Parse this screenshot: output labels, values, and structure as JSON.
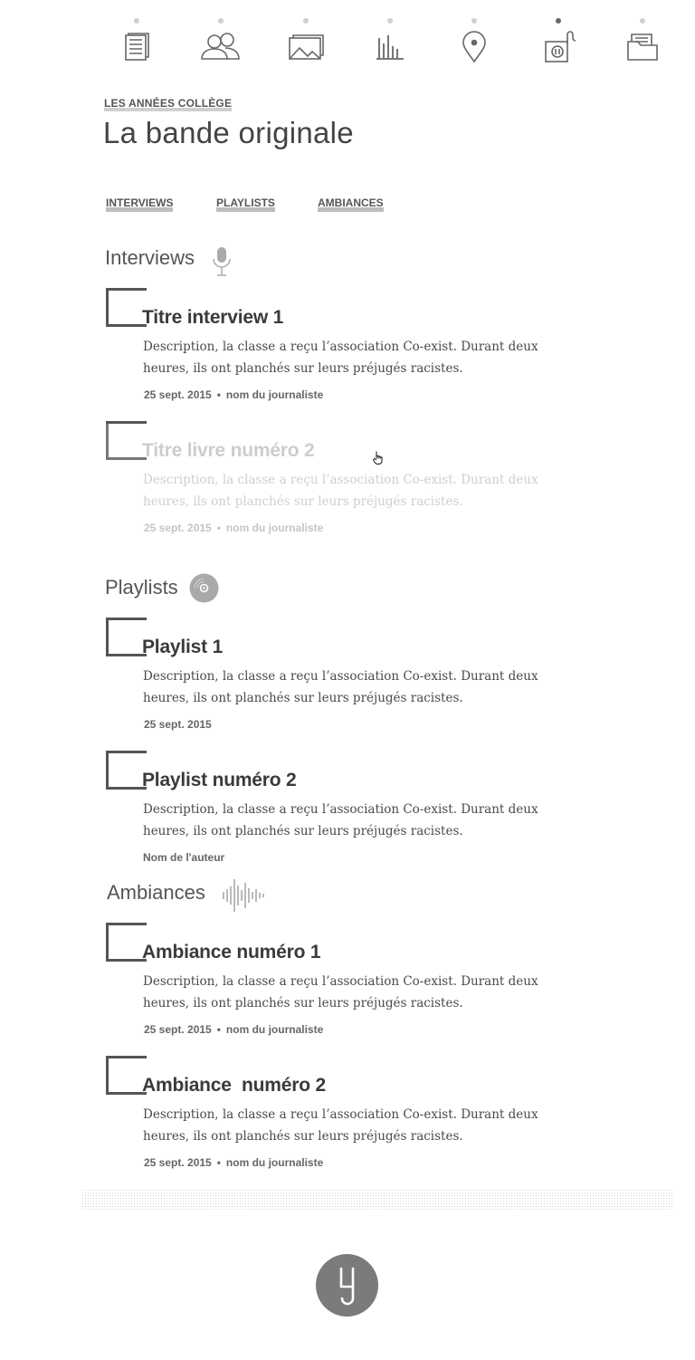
{
  "nav": {
    "items": [
      {
        "name": "articles",
        "icon": "article-icon",
        "active": false
      },
      {
        "name": "portraits",
        "icon": "people-icon",
        "active": false
      },
      {
        "name": "photos",
        "icon": "photo-icon",
        "active": false
      },
      {
        "name": "stats",
        "icon": "chart-icon",
        "active": false
      },
      {
        "name": "map",
        "icon": "location-pin-icon",
        "active": false
      },
      {
        "name": "audio",
        "icon": "radio-icon",
        "active": true
      },
      {
        "name": "archive",
        "icon": "folder-icon",
        "active": false
      }
    ]
  },
  "header": {
    "kicker": "LES ANNÉES COLLÈGE",
    "title": "La bande originale"
  },
  "tabs": [
    "INTERVIEWS",
    "PLAYLISTS",
    "AMBIANCES"
  ],
  "sections": {
    "interviews": {
      "title": "Interviews",
      "icon": "microphone-icon",
      "cards": [
        {
          "title": "Titre interview 1",
          "desc": "Description, la classe a reçu l’association Co-exist. Durant deux heures, ils ont planchés sur leurs préjugés racistes.",
          "date": "25 sept. 2015",
          "sep": "•",
          "author": "nom du journaliste"
        },
        {
          "title": "Titre livre numéro 2",
          "desc": "Description, la classe a reçu l’association Co-exist. Durant deux heures, ils ont planchés sur leurs préjugés racistes.",
          "date": "25 sept. 2015",
          "sep": "•",
          "author": "nom du journaliste"
        }
      ]
    },
    "playlists": {
      "title": "Playlists",
      "icon": "vinyl-disc-icon",
      "cards": [
        {
          "title": "Playlist 1",
          "desc": "Description, la classe a reçu l’association Co-exist. Durant deux heures, ils ont planchés sur leurs préjugés racistes.",
          "date": "25 sept. 2015"
        },
        {
          "title": "Playlist numéro 2",
          "desc": "Description, la classe a reçu l’association Co-exist. Durant deux heures, ils ont planchés sur leurs préjugés racistes.",
          "author": "Nom de l'auteur"
        }
      ]
    },
    "ambiances": {
      "title": "Ambiances",
      "icon": "soundwave-icon",
      "cards": [
        {
          "title": "Ambiance numéro 1",
          "desc": "Description, la classe a reçu l’association Co-exist. Durant deux heures, ils ont planchés sur leurs préjugés racistes.",
          "date": "25 sept. 2015",
          "sep": "•",
          "author": "nom du journaliste"
        },
        {
          "title": "Ambiance  numéro 2",
          "desc": "Description, la classe a reçu l’association Co-exist. Durant deux heures, ils ont planchés sur leurs préjugés racistes.",
          "date": "25 sept. 2015",
          "sep": "•",
          "author": "nom du journaliste"
        }
      ]
    }
  },
  "footer": {
    "logo_icon": "brand-logo-icon"
  },
  "colors": {
    "text": "#444444",
    "accent_underline": "#cfcfcf",
    "icon_gray": "#666666",
    "logo_bg": "#7b7b7b"
  }
}
